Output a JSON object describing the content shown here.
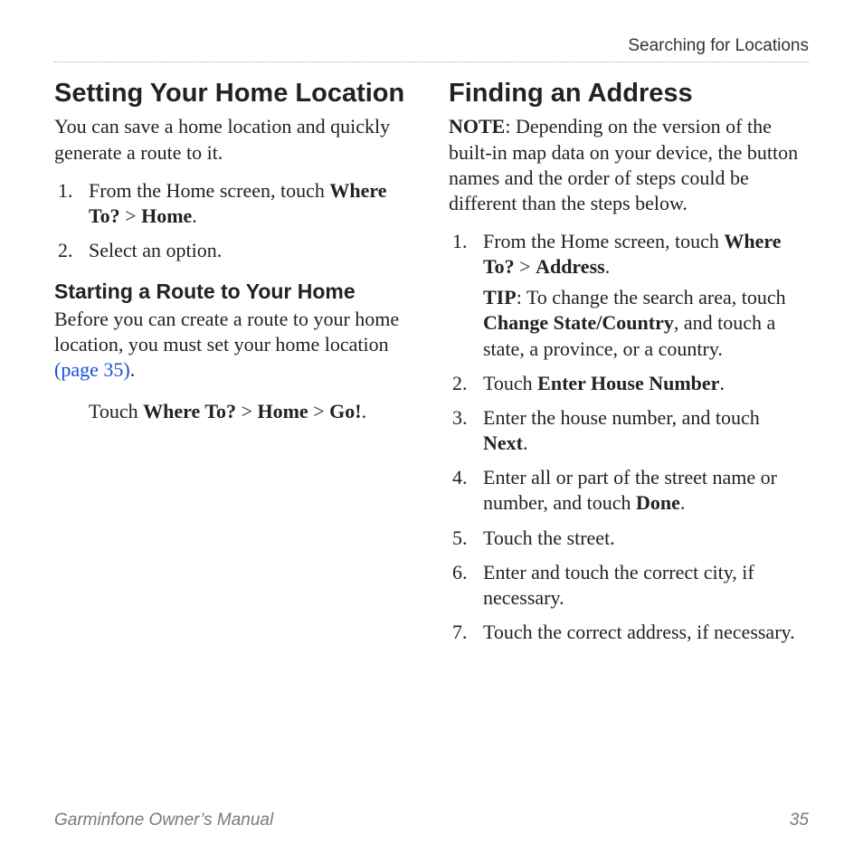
{
  "header": {
    "chapter": "Searching for Locations"
  },
  "left": {
    "h_setting": "Setting Your Home Location",
    "intro": "You can save a home location and quickly generate a route to it.",
    "step1_pre": "From the Home screen, touch ",
    "step1_b1": "Where To?",
    "step1_gt": " > ",
    "step1_b2": "Home",
    "step1_post": ".",
    "step2": "Select an option.",
    "h_start": "Starting a Route to Your Home",
    "start_body_pre": "Before you can create a route to your home location, you must set your home location ",
    "start_link": "(page 35)",
    "start_body_post": ".",
    "touch_pre": "Touch ",
    "touch_b1": "Where To?",
    "touch_gt1": " > ",
    "touch_b2": "Home",
    "touch_gt2": " > ",
    "touch_b3": "Go!",
    "touch_post": "."
  },
  "right": {
    "h_finding": "Finding an Address",
    "note_label": "NOTE",
    "note_body": ": Depending on the version of the built-in map data on your device, the button names and the order of steps could be different than the steps below.",
    "s1_pre": "From the Home screen, touch ",
    "s1_b1": "Where To?",
    "s1_gt": " > ",
    "s1_b2": "Address",
    "s1_post": ".",
    "tip_label": "TIP",
    "tip_pre": ": To change the search area, touch ",
    "tip_b": "Change State/Country",
    "tip_post": ", and touch a state, a province, or a country.",
    "s2_pre": "Touch ",
    "s2_b": "Enter House Number",
    "s2_post": ".",
    "s3_pre": "Enter the house number, and touch ",
    "s3_b": "Next",
    "s3_post": ".",
    "s4_pre": "Enter all or part of the street name or number, and touch ",
    "s4_b": "Done",
    "s4_post": ".",
    "s5": "Touch the street.",
    "s6": "Enter and touch the correct city, if necessary.",
    "s7": "Touch the correct address, if necessary."
  },
  "footer": {
    "manual": "Garminfone Owner’s Manual",
    "page": "35"
  }
}
